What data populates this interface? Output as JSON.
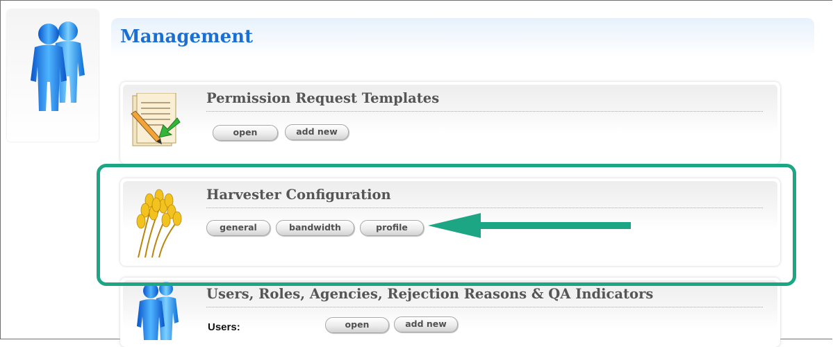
{
  "page": {
    "title": "Management"
  },
  "sections": [
    {
      "title": "Permission Request Templates",
      "icon": "document-edit-icon",
      "buttons": [
        {
          "label": "open"
        },
        {
          "label": "add new"
        }
      ]
    },
    {
      "title": "Harvester Configuration",
      "icon": "wheat-icon",
      "buttons": [
        {
          "label": "general"
        },
        {
          "label": "bandwidth"
        },
        {
          "label": "profile"
        }
      ]
    },
    {
      "title": "Users, Roles, Agencies, Rejection Reasons & QA Indicators",
      "icon": "users-icon",
      "rows": [
        {
          "label": "Users:",
          "buttons": [
            {
              "label": "open"
            },
            {
              "label": "add new"
            }
          ]
        }
      ]
    }
  ],
  "annotation": {
    "highlight_color": "#1da684",
    "highlight_target": "Harvester Configuration",
    "arrow_target": "profile"
  }
}
